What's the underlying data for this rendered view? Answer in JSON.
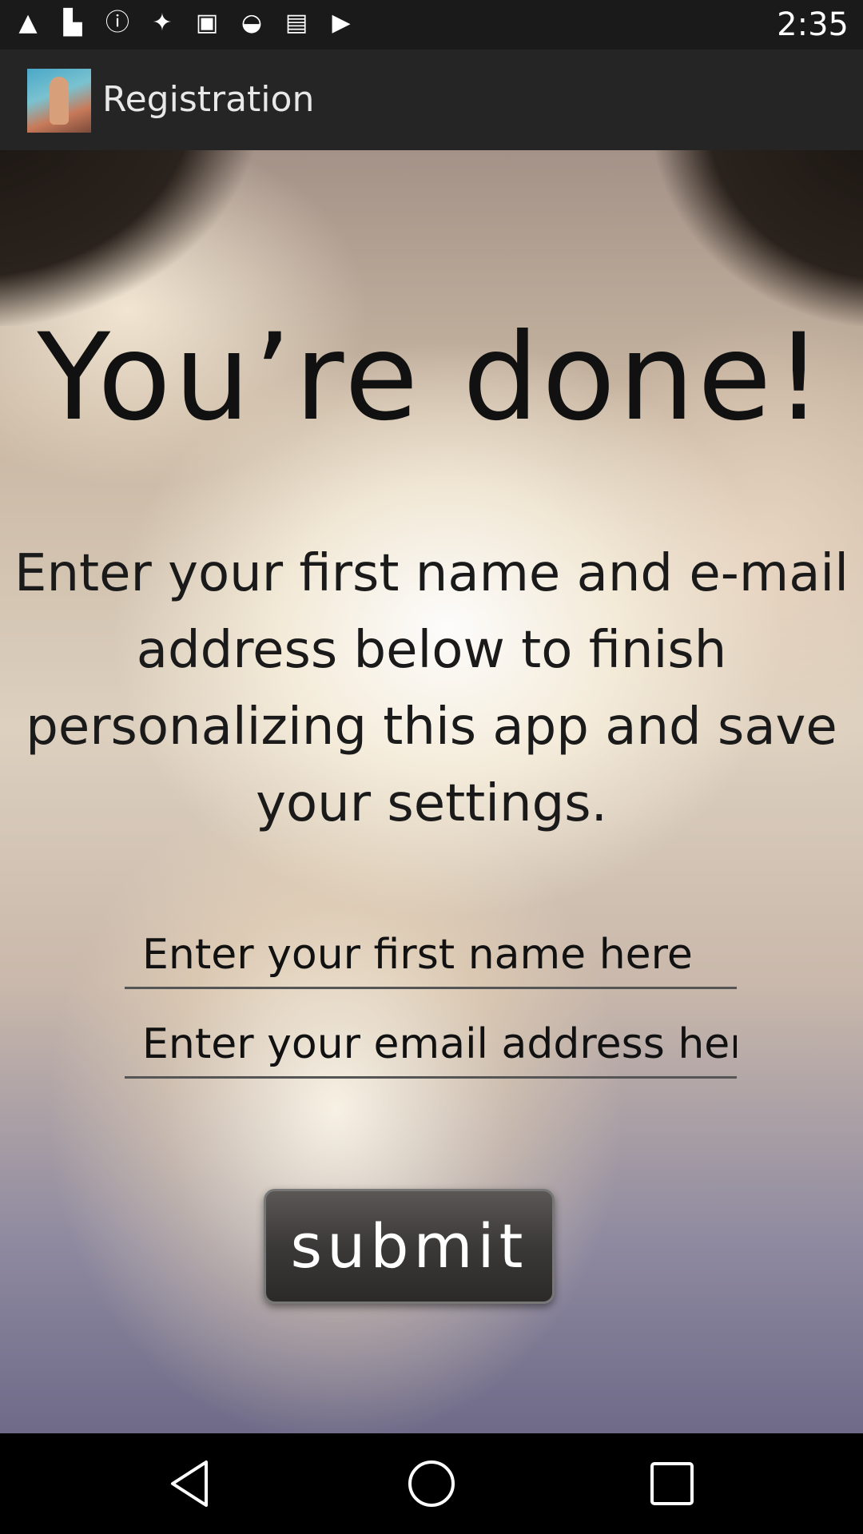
{
  "status_bar": {
    "time": "2:35",
    "icons": [
      "signal-icon",
      "flipboard-icon",
      "alert-icon",
      "satellite-icon",
      "lock-icon",
      "android-icon",
      "inbox-icon",
      "play-store-icon"
    ]
  },
  "app_bar": {
    "title": "Registration"
  },
  "content": {
    "headline": "You’re done!",
    "instructions": "Enter your first name and e-mail address below to finish personalizing this app and save your settings.",
    "first_name_placeholder": "Enter your first name here",
    "email_placeholder": "Enter your email address here",
    "submit_label": "submit"
  },
  "nav_bar": {
    "buttons": [
      "back-icon",
      "home-icon",
      "recent-apps-icon"
    ]
  }
}
